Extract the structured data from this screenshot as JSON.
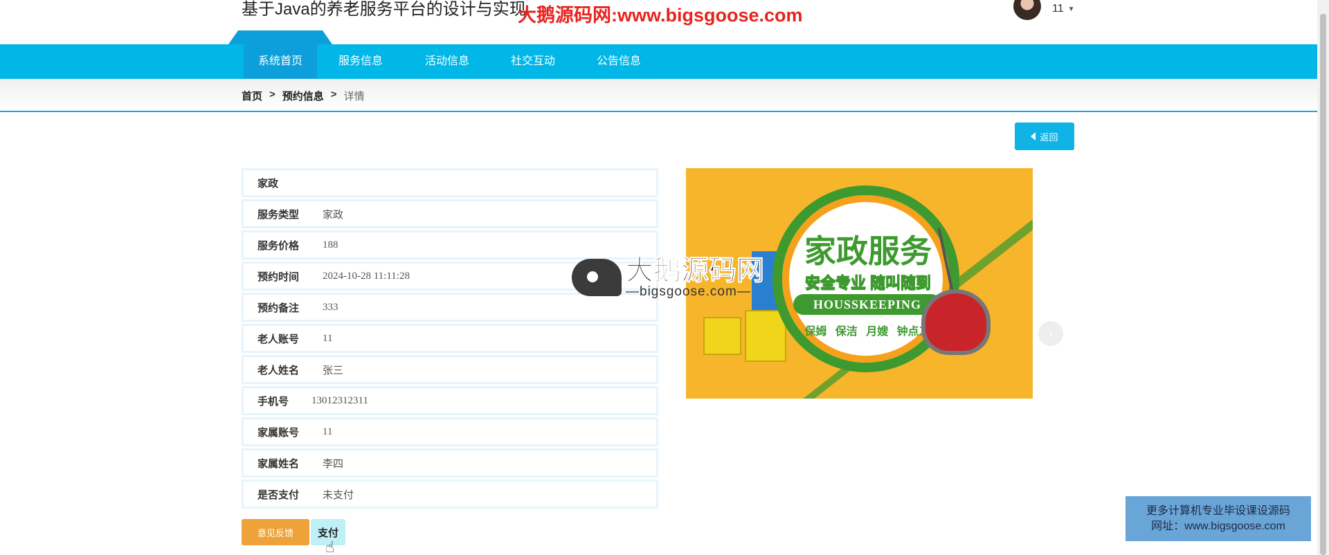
{
  "header": {
    "site_title": "基于Java的养老服务平台的设计与实现",
    "watermark_text": "大鹅源码网:www.bigsgoose.com",
    "user_name": "11",
    "caret_glyph": "▼"
  },
  "nav": {
    "items": [
      {
        "label": "系统首页",
        "active": true
      },
      {
        "label": "服务信息",
        "active": false
      },
      {
        "label": "活动信息",
        "active": false
      },
      {
        "label": "社交互动",
        "active": false
      },
      {
        "label": "公告信息",
        "active": false
      }
    ],
    "accent_color": "#00b7e8"
  },
  "breadcrumb": {
    "home": "首页",
    "sep": ">",
    "section": "预约信息",
    "current": "详情"
  },
  "back_button": {
    "label": "返回"
  },
  "detail": {
    "title": "家政",
    "rows": [
      {
        "label": "服务类型",
        "value": "家政"
      },
      {
        "label": "服务价格",
        "value": "188"
      },
      {
        "label": "预约时间",
        "value": "2024-10-28 11:11:28"
      },
      {
        "label": "预约备注",
        "value": "333"
      },
      {
        "label": "老人账号",
        "value": "11"
      },
      {
        "label": "老人姓名",
        "value": "张三"
      },
      {
        "label": "手机号",
        "value": "13012312311"
      },
      {
        "label": "家属账号",
        "value": "11"
      },
      {
        "label": "家属姓名",
        "value": "李四"
      },
      {
        "label": "是否支付",
        "value": "未支付"
      }
    ]
  },
  "actions": {
    "feedback_label": "意见反馈",
    "pay_label": "支付"
  },
  "banner": {
    "headline": "家政服务",
    "subline": "安全专业 随叫随到",
    "ribbon": "HOUSSKEEPING",
    "services": "保姆 保洁 月嫂 钟点工",
    "next_glyph": "›"
  },
  "watermark_logo": {
    "big": "大鹅源码网",
    "small": "—bigsgoose.com—"
  },
  "promo": {
    "line1": "更多计算机专业毕设课设源码",
    "line2": "网址：www.bigsgoose.com"
  }
}
